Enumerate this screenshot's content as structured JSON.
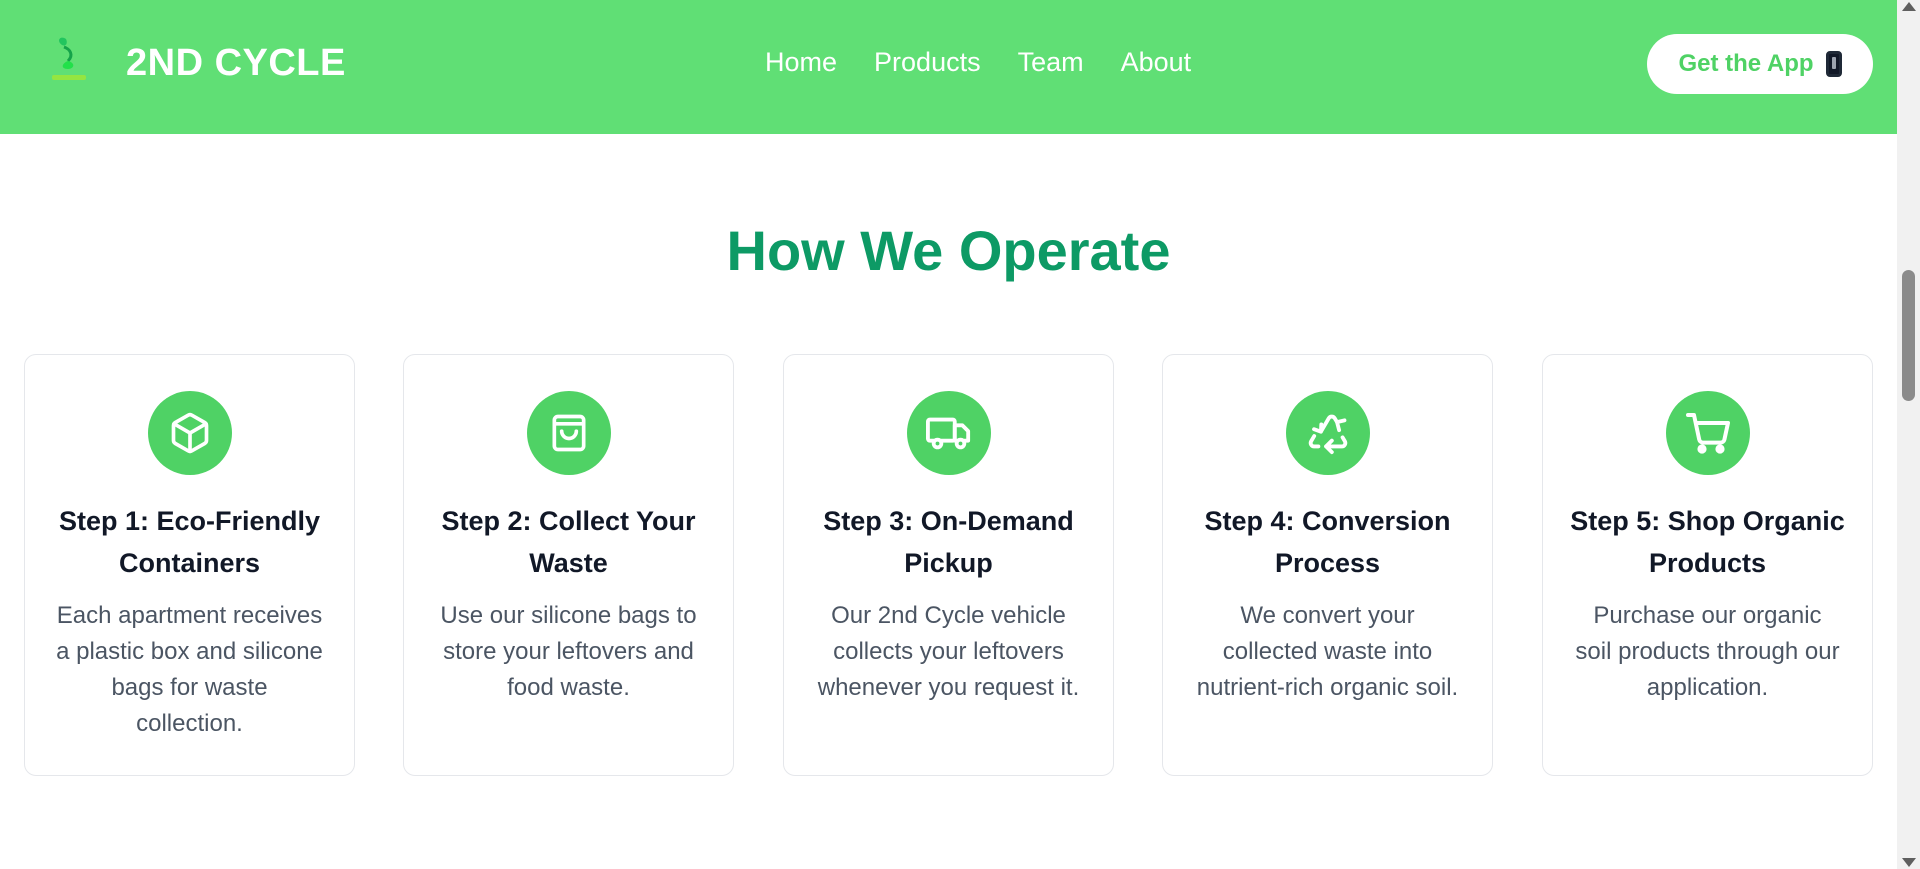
{
  "header": {
    "brand": "2ND CYCLE",
    "logo_icon": "sprout-logo-icon",
    "nav": [
      {
        "label": "Home"
      },
      {
        "label": "Products"
      },
      {
        "label": "Team"
      },
      {
        "label": "About"
      }
    ],
    "cta_label": "Get the App",
    "cta_icon": "mobile-phone-icon"
  },
  "colors": {
    "header_bg": "#60df75",
    "accent": "#4fd265",
    "title": "#0d9a65",
    "body_text": "#4b5563"
  },
  "section": {
    "title": "How We Operate",
    "steps": [
      {
        "icon": "box-icon",
        "title": "Step 1: Eco-Friendly Containers",
        "text": "Each apartment receives a plastic box and silicone bags for waste collection."
      },
      {
        "icon": "shopping-bag-icon",
        "title": "Step 2: Collect Your Waste",
        "text": "Use our silicone bags to store your leftovers and food waste."
      },
      {
        "icon": "truck-icon",
        "title": "Step 3: On-Demand Pickup",
        "text": "Our 2nd Cycle vehicle collects your leftovers whenever you request it."
      },
      {
        "icon": "recycle-icon",
        "title": "Step 4: Conversion Process",
        "text": "We convert your collected waste into nutrient-rich organic soil."
      },
      {
        "icon": "shopping-cart-icon",
        "title": "Step 5: Shop Organic Products",
        "text": "Purchase our organic soil products through our application."
      }
    ]
  }
}
